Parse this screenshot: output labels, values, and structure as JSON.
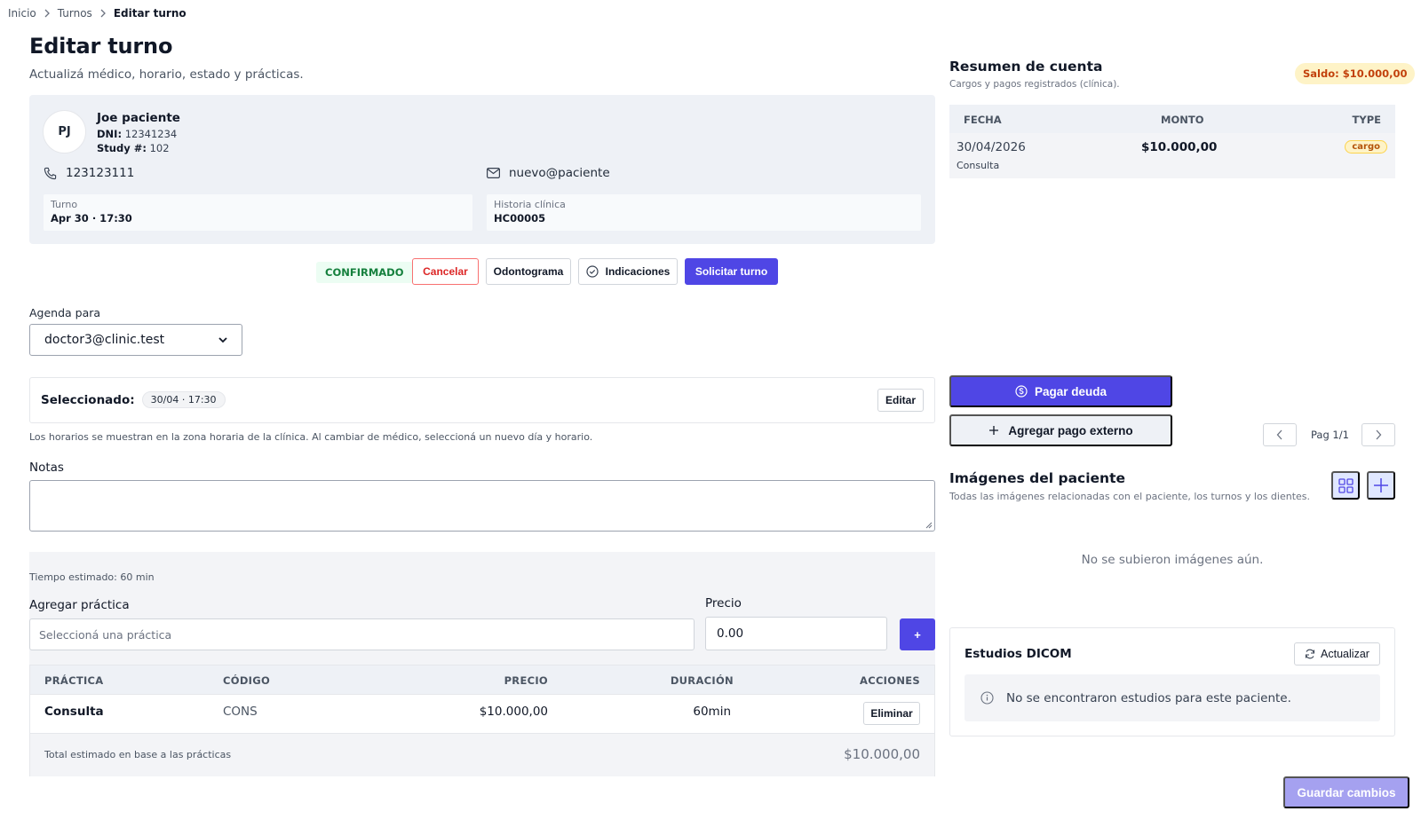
{
  "breadcrumb": {
    "items": [
      "Inicio",
      "Turnos"
    ],
    "current": "Editar turno"
  },
  "page": {
    "title": "Editar turno",
    "subtitle": "Actualizá médico, horario, estado y prácticas."
  },
  "patient": {
    "initials": "PJ",
    "name": "Joe paciente",
    "dni_label": "DNI:",
    "dni": "12341234",
    "study_label": "Study #:",
    "study": "102",
    "phone": "123123111",
    "email": "nuevo@paciente",
    "turno_label": "Turno",
    "turno": "Apr 30 · 17:30",
    "historia_label": "Historia clínica",
    "historia": "HC00005"
  },
  "actions": {
    "status": "CONFIRMADO",
    "cancel": "Cancelar",
    "odontograma": "Odontograma",
    "indicaciones": "Indicaciones",
    "solicitar": "Solicitar turno"
  },
  "agenda": {
    "label": "Agenda para",
    "selected": "doctor3@clinic.test"
  },
  "selection": {
    "label": "Seleccionado:",
    "value": "30/04 · 17:30",
    "edit": "Editar",
    "hint": "Los horarios se muestran en la zona horaria de la clínica. Al cambiar de médico, seleccioná un nuevo día y horario."
  },
  "notes": {
    "label": "Notas",
    "value": ""
  },
  "practices": {
    "estimated_time": "Tiempo estimado: 60 min",
    "add_label": "Agregar práctica",
    "add_placeholder": "Seleccioná una práctica",
    "price_label": "Precio",
    "price_value": "0.00",
    "add_button": "+",
    "columns": [
      "PRÁCTICA",
      "CÓDIGO",
      "PRECIO",
      "DURACIÓN",
      "ACCIONES"
    ],
    "rows": [
      {
        "practice": "Consulta",
        "code": "CONS",
        "price": "$10.000,00",
        "duration": "60min",
        "action": "Eliminar"
      }
    ],
    "total_label": "Total estimado en base a las prácticas",
    "total": "$10.000,00"
  },
  "account": {
    "title": "Resumen de cuenta",
    "subtitle": "Cargos y pagos registrados (clínica).",
    "saldo": "Saldo: $10.000,00",
    "columns": [
      "FECHA",
      "MONTO",
      "TYPE"
    ],
    "rows": [
      {
        "date": "30/04/2026",
        "desc": "Consulta",
        "amount": "$10.000,00",
        "type": "cargo"
      }
    ],
    "pay_button": "Pagar deuda",
    "external_button": "Agregar pago externo",
    "page": "Pag 1/1"
  },
  "images": {
    "title": "Imágenes del paciente",
    "subtitle": "Todas las imágenes relacionadas con el paciente, los turnos y los dientes.",
    "empty": "No se subieron imágenes aún."
  },
  "dicom": {
    "title": "Estudios DICOM",
    "refresh": "Actualizar",
    "empty": "No se encontraron estudios para este paciente."
  },
  "save_button": "Guardar cambios",
  "colors": {
    "primary": "#4f46e5",
    "success": "#15803d",
    "danger": "#dc2626",
    "warning": "#c2410c"
  }
}
